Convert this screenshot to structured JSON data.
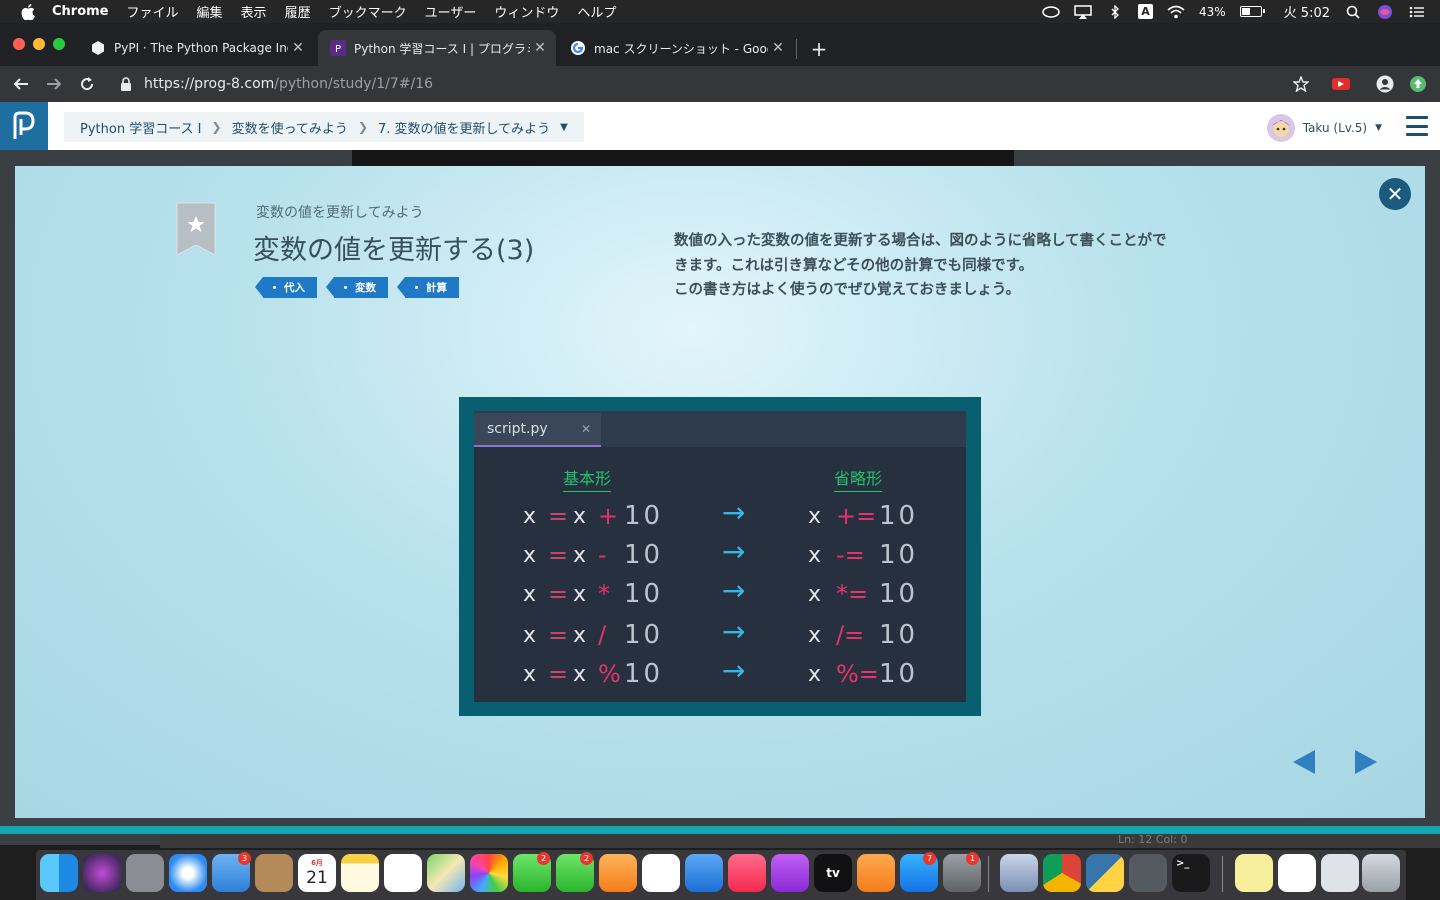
{
  "menubar": {
    "app_name": "Chrome",
    "menus": [
      "ファイル",
      "編集",
      "表示",
      "履歴",
      "ブックマーク",
      "ユーザー",
      "ウィンドウ",
      "ヘルプ"
    ],
    "battery": "43%",
    "clock": "火 5:02",
    "input_indicator": "A"
  },
  "browser": {
    "tabs": [
      {
        "title": "PyPI · The Python Package Index",
        "active": false
      },
      {
        "title": "Python 学習コース I | プログラミング",
        "active": true
      },
      {
        "title": "mac スクリーンショット - Google 検索",
        "active": false
      }
    ],
    "url_host": "https://prog-8.com",
    "url_path": "/python/study/1/7#/16"
  },
  "site": {
    "breadcrumbs": [
      "Python 学習コース I",
      "変数を使ってみよう",
      "7. 変数の値を更新してみよう"
    ],
    "user_label": "Taku (Lv.5)"
  },
  "slide": {
    "subtitle": "変数の値を更新してみよう",
    "title": "変数の値を更新する(3)",
    "tags": [
      "代入",
      "変数",
      "計算"
    ],
    "description": [
      "数値の入った変数の値を更新する場合は、図のように省略して書くことがで",
      "きます。これは引き算などその他の計算でも同様です。",
      "この書き方はよく使うのでぜひ覚えておきましょう。"
    ],
    "editor_tab": "script.py",
    "left_heading": "基本形",
    "right_heading": "省略形",
    "rows": [
      {
        "var": "x",
        "eq": "=",
        "var2": "x",
        "op": "+",
        "num": "10",
        "arrow": "→",
        "short_op": "+=",
        "short_num": "10"
      },
      {
        "var": "x",
        "eq": "=",
        "var2": "x",
        "op": "-",
        "num": "10",
        "arrow": "→",
        "short_op": "-=",
        "short_num": "10"
      },
      {
        "var": "x",
        "eq": "=",
        "var2": "x",
        "op": "*",
        "num": "10",
        "arrow": "→",
        "short_op": "*=",
        "short_num": "10"
      },
      {
        "var": "x",
        "eq": "=",
        "var2": "x",
        "op": "/",
        "num": "10",
        "arrow": "→",
        "short_op": "/=",
        "short_num": "10"
      },
      {
        "var": "x",
        "eq": "=",
        "var2": "x",
        "op": "%",
        "num": "10",
        "arrow": "→",
        "short_op": "%=",
        "short_num": "10"
      }
    ]
  },
  "background_status": "Ln: 12   Col: 0",
  "dock": {
    "badges": {
      "mail": "3",
      "messages": "2",
      "facetime": "2",
      "appstore": "7",
      "preferences": "1"
    },
    "calendar_day": "21",
    "calendar_month": "6月"
  },
  "colors": {
    "accent_blue": "#1f79c6",
    "modal_bg": "#b7e1ec",
    "code_green": "#22c36a",
    "code_pink": "#e5336d",
    "arrow_blue": "#34b6ea"
  }
}
